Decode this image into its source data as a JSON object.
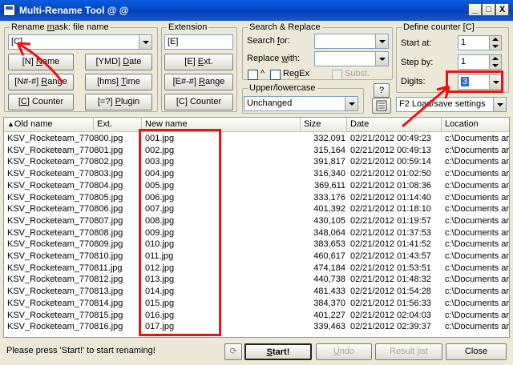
{
  "window": {
    "title": "Multi-Rename Tool @ @",
    "min": "_",
    "max": "□",
    "close": "X"
  },
  "rename_mask": {
    "legend_pre": "Rename ",
    "legend_u": "m",
    "legend_post": "ask: file name",
    "value": "[C]",
    "buttons": [
      {
        "pre": "[N] ",
        "u": "N",
        "post": "ame"
      },
      {
        "pre": "[YMD] ",
        "u": "D",
        "post": "ate"
      },
      {
        "pre": "[N#-#] ",
        "u": "R",
        "post": "ange"
      },
      {
        "pre": "[hms] ",
        "u": "T",
        "post": "ime"
      },
      {
        "pre": "[",
        "u": "C",
        "post": "] Counter"
      },
      {
        "pre": "[=?] ",
        "u": "P",
        "post": "lugin"
      }
    ]
  },
  "extension": {
    "legend": "Extension",
    "value": "[E]",
    "buttons": [
      {
        "pre": "[E] ",
        "u": "E",
        "post": "xt."
      },
      {
        "pre": "[E#-#] ",
        "u": "R",
        "post": "ange"
      },
      {
        "pre": "[C] Counter",
        "u": "",
        "post": ""
      }
    ]
  },
  "search_replace": {
    "legend": "Search & Replace",
    "search_label_pre": "Search ",
    "search_label_u": "f",
    "search_label_post": "or:",
    "replace_label_pre": "Replace ",
    "replace_label_u": "w",
    "replace_label_post": "ith:",
    "caret": "^",
    "regex": "RegEx",
    "subst": "Subst."
  },
  "case": {
    "legend": "Upper/lowercase",
    "value": "Unchanged",
    "help": "?"
  },
  "counter": {
    "legend": "Define counter [C]",
    "start_label": "Start at:",
    "start_value": "1",
    "step_label": "Step by:",
    "step_value": "1",
    "digits_label": "Digits:",
    "digits_value": "3"
  },
  "settings": {
    "value": "F2 Load/save settings"
  },
  "columns": [
    "Old name",
    "Ext.",
    "New name",
    "Size",
    "Date",
    "Location"
  ],
  "rows": [
    {
      "old": "KSV_Rocketeam_770800.jpg",
      "new": "001.jpg",
      "size": "332,091",
      "date": "02/21/2012 00:49:23",
      "loc": "c:\\Documents ar"
    },
    {
      "old": "KSV_Rocketeam_770801.jpg",
      "new": "002.jpg",
      "size": "315,164",
      "date": "02/21/2012 00:49:13",
      "loc": "c:\\Documents ar"
    },
    {
      "old": "KSV_Rocketeam_770802.jpg",
      "new": "003.jpg",
      "size": "391,817",
      "date": "02/21/2012 00:59:14",
      "loc": "c:\\Documents ar"
    },
    {
      "old": "KSV_Rocketeam_770803.jpg",
      "new": "004.jpg",
      "size": "316,340",
      "date": "02/21/2012 01:02:50",
      "loc": "c:\\Documents ar"
    },
    {
      "old": "KSV_Rocketeam_770804.jpg",
      "new": "005.jpg",
      "size": "369,611",
      "date": "02/21/2012 01:08:36",
      "loc": "c:\\Documents ar"
    },
    {
      "old": "KSV_Rocketeam_770805.jpg",
      "new": "006.jpg",
      "size": "333,176",
      "date": "02/21/2012 01:14:40",
      "loc": "c:\\Documents ar"
    },
    {
      "old": "KSV_Rocketeam_770806.jpg",
      "new": "007.jpg",
      "size": "401,392",
      "date": "02/21/2012 01:18:10",
      "loc": "c:\\Documents ar"
    },
    {
      "old": "KSV_Rocketeam_770807.jpg",
      "new": "008.jpg",
      "size": "430,105",
      "date": "02/21/2012 01:19:57",
      "loc": "c:\\Documents ar"
    },
    {
      "old": "KSV_Rocketeam_770808.jpg",
      "new": "009.jpg",
      "size": "348,064",
      "date": "02/21/2012 01:37:53",
      "loc": "c:\\Documents ar"
    },
    {
      "old": "KSV_Rocketeam_770809.jpg",
      "new": "010.jpg",
      "size": "383,653",
      "date": "02/21/2012 01:41:52",
      "loc": "c:\\Documents ar"
    },
    {
      "old": "KSV_Rocketeam_770810.jpg",
      "new": "011.jpg",
      "size": "460,617",
      "date": "02/21/2012 01:43:57",
      "loc": "c:\\Documents ar"
    },
    {
      "old": "KSV_Rocketeam_770811.jpg",
      "new": "012.jpg",
      "size": "474,184",
      "date": "02/21/2012 01:53:51",
      "loc": "c:\\Documents ar"
    },
    {
      "old": "KSV_Rocketeam_770812.jpg",
      "new": "013.jpg",
      "size": "440,738",
      "date": "02/21/2012 01:48:32",
      "loc": "c:\\Documents ar"
    },
    {
      "old": "KSV_Rocketeam_770813.jpg",
      "new": "014.jpg",
      "size": "481,433",
      "date": "02/21/2012 01:54:28",
      "loc": "c:\\Documents ar"
    },
    {
      "old": "KSV_Rocketeam_770814.jpg",
      "new": "015.jpg",
      "size": "384,370",
      "date": "02/21/2012 01:56:33",
      "loc": "c:\\Documents ar"
    },
    {
      "old": "KSV_Rocketeam_770815.jpg",
      "new": "016.jpg",
      "size": "401,227",
      "date": "02/21/2012 02:04:03",
      "loc": "c:\\Documents ar"
    },
    {
      "old": "KSV_Rocketeam_770816.jpg",
      "new": "017.jpg",
      "size": "339,463",
      "date": "02/21/2012 02:39:37",
      "loc": "c:\\Documents ar"
    }
  ],
  "status": {
    "message": "Please press 'Start!' to start renaming!",
    "start": "Start!",
    "start_u": "S",
    "start_post": "tart!",
    "undo": "Undo",
    "undo_u": "U",
    "undo_post": "ndo",
    "result": "Result list",
    "result_pre": "Result ",
    "result_u": "l",
    "result_post": "ist",
    "close": "Close"
  },
  "colors": {
    "annotation": "#e11111",
    "title_blue": "#0a5ce0",
    "face": "#ece9d8"
  },
  "icons": {
    "app": "app-icon",
    "sort": "sort-up-arrow-icon",
    "refresh": "refresh-icon",
    "settings": "list-icon"
  }
}
